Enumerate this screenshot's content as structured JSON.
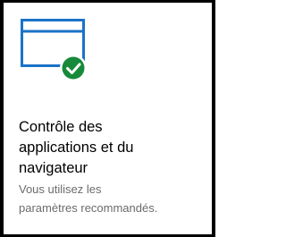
{
  "tile": {
    "icon": "browser-window-icon",
    "badge_icon": "checkmark-icon",
    "title_lines": [
      "Contrôle des",
      "applications et du",
      "navigateur"
    ],
    "status_lines": [
      "Vous utilisez les",
      "paramètres recommandés."
    ]
  },
  "colors": {
    "icon_blue": "#1a73c8",
    "ok_green": "#168a3a",
    "title_text": "#000000",
    "status_text": "#6b6b6b"
  }
}
